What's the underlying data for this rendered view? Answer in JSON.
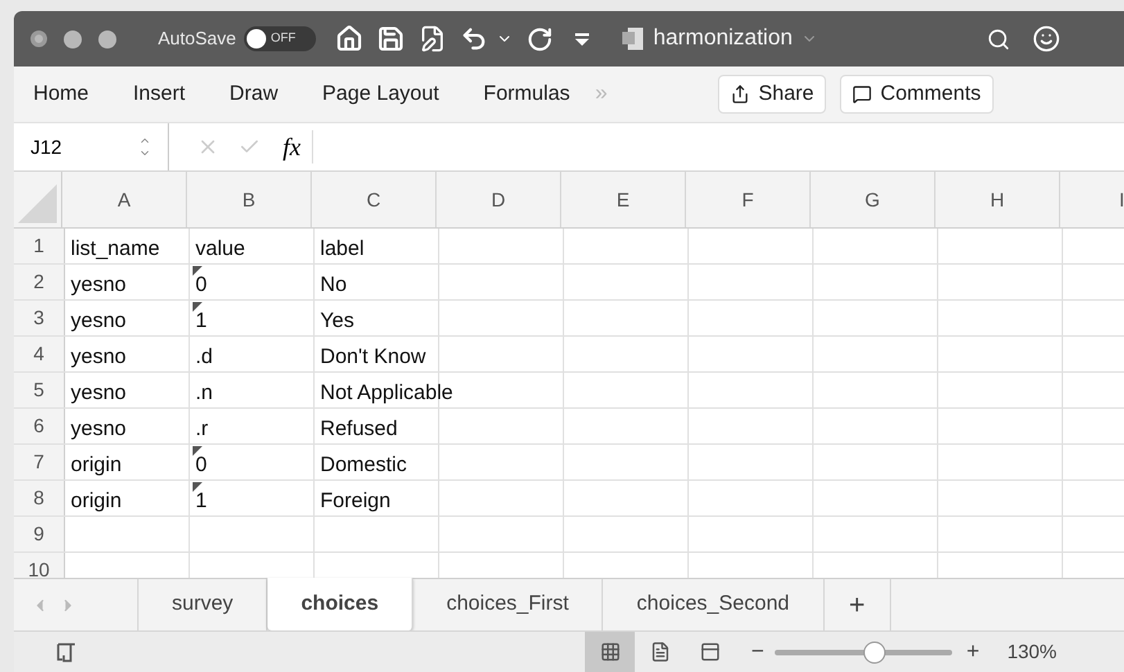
{
  "title_bar": {
    "autosave_label": "AutoSave",
    "autosave": {
      "on": false,
      "text": "OFF"
    },
    "document": "harmonization"
  },
  "ribbon": {
    "tabs": [
      "Home",
      "Insert",
      "Draw",
      "Page Layout",
      "Formulas"
    ],
    "more": "»",
    "buttons": [
      "Share",
      "Comments"
    ]
  },
  "formula_bar": {
    "name_box": "J12",
    "fx": "fx"
  },
  "sheet": {
    "columns": [
      "A",
      "B",
      "C",
      "D",
      "E",
      "F",
      "G",
      "H",
      "I"
    ],
    "rows": [
      {
        "number": "1",
        "cells": [
          {
            "text": "list_name",
            "flag": false
          },
          {
            "text": "value",
            "flag": false
          },
          {
            "text": "label",
            "flag": false
          }
        ]
      },
      {
        "number": "2",
        "cells": [
          {
            "text": "yesno",
            "flag": false
          },
          {
            "text": "0",
            "flag": true
          },
          {
            "text": "No",
            "flag": false
          }
        ]
      },
      {
        "number": "3",
        "cells": [
          {
            "text": "yesno",
            "flag": false
          },
          {
            "text": "1",
            "flag": true
          },
          {
            "text": "Yes",
            "flag": false
          }
        ]
      },
      {
        "number": "4",
        "cells": [
          {
            "text": "yesno",
            "flag": false
          },
          {
            "text": ".d",
            "flag": false
          },
          {
            "text": "Don't Know",
            "flag": false
          }
        ]
      },
      {
        "number": "5",
        "cells": [
          {
            "text": "yesno",
            "flag": false
          },
          {
            "text": ".n",
            "flag": false
          },
          {
            "text": "Not Applicable",
            "flag": false
          }
        ]
      },
      {
        "number": "6",
        "cells": [
          {
            "text": "yesno",
            "flag": false
          },
          {
            "text": ".r",
            "flag": false
          },
          {
            "text": "Refused",
            "flag": false
          }
        ]
      },
      {
        "number": "7",
        "cells": [
          {
            "text": "origin",
            "flag": false
          },
          {
            "text": "0",
            "flag": true
          },
          {
            "text": "Domestic",
            "flag": false
          }
        ]
      },
      {
        "number": "8",
        "cells": [
          {
            "text": "origin",
            "flag": false
          },
          {
            "text": "1",
            "flag": true
          },
          {
            "text": "Foreign",
            "flag": false
          }
        ]
      },
      {
        "number": "9",
        "cells": []
      },
      {
        "number": "10",
        "cells": []
      }
    ]
  },
  "sheet_tabs": [
    {
      "label": "survey",
      "selected": false
    },
    {
      "label": "choices",
      "selected": true
    },
    {
      "label": "choices_First",
      "selected": false
    },
    {
      "label": "choices_Second",
      "selected": false
    }
  ],
  "add_sheet": "+",
  "status_bar": {
    "views": [
      {
        "kind": "normal",
        "selected": true
      },
      {
        "kind": "page",
        "selected": false
      },
      {
        "kind": "break",
        "selected": false
      }
    ],
    "zoom_minus": "−",
    "zoom_plus": "+",
    "zoom": {
      "level": 0.57
    },
    "zoom_text": "130%"
  }
}
